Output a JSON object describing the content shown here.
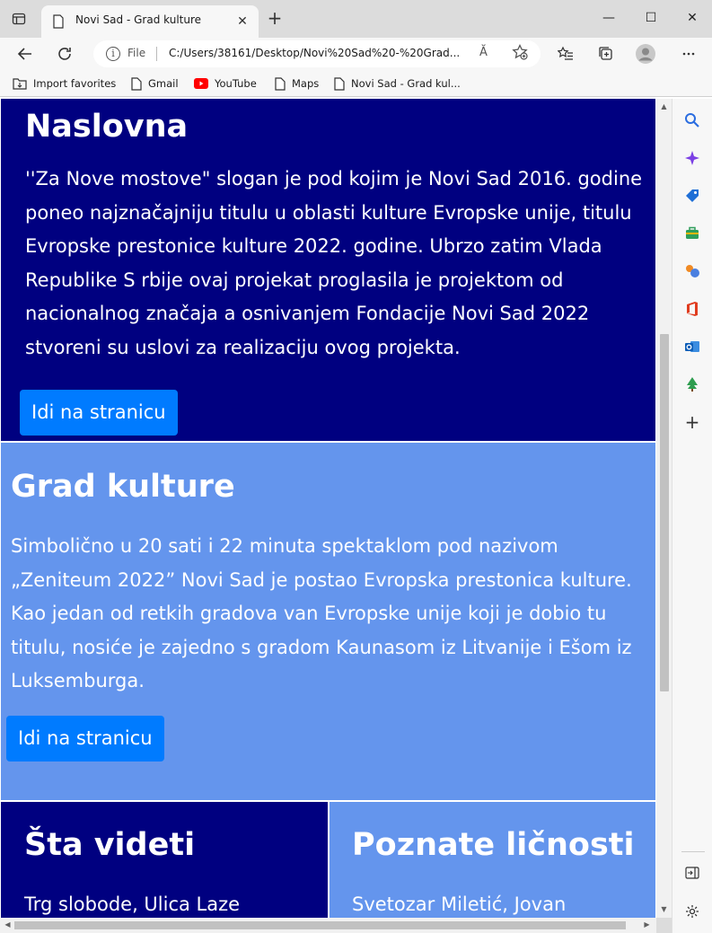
{
  "tab": {
    "title": "Novi Sad - Grad kulture",
    "close_glyph": "✕",
    "new_tab_glyph": "+"
  },
  "window": {
    "minimize": "—",
    "maximize": "☐",
    "close": "✕"
  },
  "address": {
    "scheme_label": "File",
    "url": "C:/Users/38161/Desktop/Novi%20Sad%20-%20Grad...",
    "read_aloud": "Ă",
    "info_glyph": "i"
  },
  "bookmarks": [
    {
      "label": "Import favorites",
      "icon": "import-icon"
    },
    {
      "label": "Gmail",
      "icon": "page-icon"
    },
    {
      "label": "YouTube",
      "icon": "youtube-icon"
    },
    {
      "label": "Maps",
      "icon": "page-icon"
    },
    {
      "label": "Novi Sad - Grad kul...",
      "icon": "page-icon"
    }
  ],
  "sections": {
    "naslovna": {
      "title": "Naslovna",
      "text": "''Za Nove mostove\" slogan je pod kojim je Novi Sad 2016. godine poneo najznačajniju titulu u oblasti kulture Evropske unije, titulu Evropske prestonice kulture 2022. godine. Ubrzo zatim Vlada Republike S rbije ovaj projekat proglasila je projektom od nacionalnog značaja a osnivanjem Fondacije Novi Sad 2022 stvoreni su uslovi za realizaciju ovog projekta.",
      "button": "Idi na stranicu"
    },
    "grad": {
      "title": "Grad kulture",
      "text": "Simbolično u 20 sati i 22 minuta spektaklom pod nazivom „Zeniteum 2022” Novi Sad je postao Evropska prestonica kulture. Kao jedan od retkih gradova van Evropske unije koji je dobio tu titulu, nosiće je zajedno s gradom Kaunasom iz Litvanije i Ešom iz Luksemburga.",
      "button": "Idi na stranicu"
    },
    "sta": {
      "title": "Šta videti",
      "text": "Trg slobode, Ulica Laze"
    },
    "poznate": {
      "title": "Poznate ličnosti",
      "text": "Svetozar Miletić, Jovan"
    }
  },
  "colors": {
    "navy": "#000080",
    "cornflower": "#6495ed",
    "button": "#007bff"
  }
}
